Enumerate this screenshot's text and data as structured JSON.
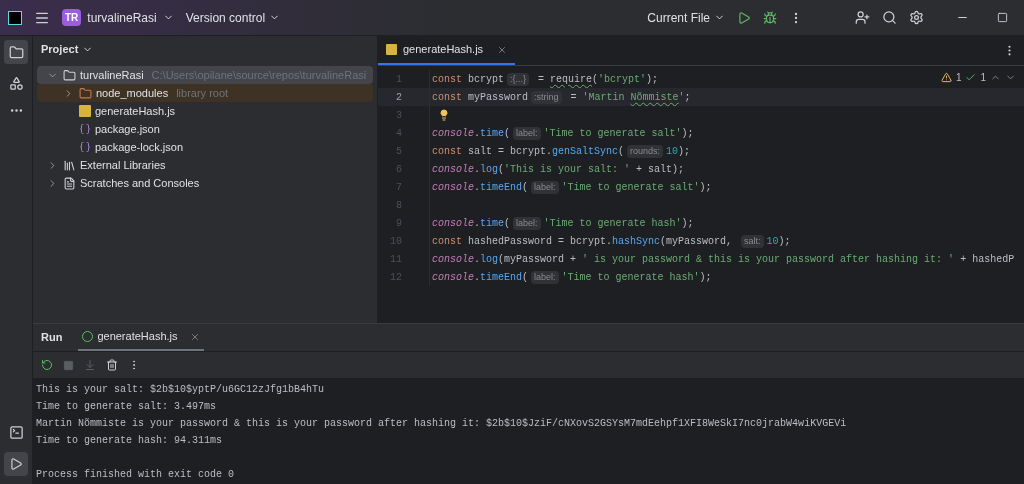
{
  "titlebar": {
    "app_initials": "TR",
    "project": "turvalineRasi",
    "vcs": "Version control",
    "run_config": "Current File"
  },
  "project_panel": {
    "title": "Project",
    "tree": [
      {
        "label": "turvalineRasi",
        "hint": "C:\\Users\\opilane\\source\\repos\\turvalineRasi",
        "kind": "folder",
        "expanded": true,
        "selected": true,
        "children": [
          {
            "label": "node_modules",
            "hint": "library root",
            "kind": "library-folder",
            "expanded": false,
            "selected": false
          },
          {
            "label": "generateHash.js",
            "kind": "js",
            "selected": false
          },
          {
            "label": "package.json",
            "kind": "json",
            "selected": false
          },
          {
            "label": "package-lock.json",
            "kind": "json",
            "selected": false
          }
        ]
      },
      {
        "label": "External Libraries",
        "kind": "library",
        "expanded": false,
        "selected": false
      },
      {
        "label": "Scratches and Consoles",
        "kind": "scratches",
        "expanded": false,
        "selected": false
      }
    ]
  },
  "editor": {
    "tabs": [
      {
        "label": "generateHash.js",
        "selected": true
      }
    ],
    "warnings": "1",
    "checks": "1",
    "lines": [
      {
        "number": "1",
        "current": false,
        "tokens": [
          {
            "kind": "kw",
            "text": "const "
          },
          {
            "kind": "plain",
            "text": "bcrypt"
          },
          {
            "kind": "hint",
            "text": ":{...}"
          },
          {
            "kind": "plain",
            "text": " = "
          },
          {
            "kind": "plain",
            "text": "require",
            "underline": true
          },
          {
            "kind": "plain",
            "text": "("
          },
          {
            "kind": "str",
            "text": "'bcrypt'"
          },
          {
            "kind": "plain",
            "text": ");"
          }
        ]
      },
      {
        "number": "2",
        "current": true,
        "tokens": [
          {
            "kind": "kw",
            "text": "const "
          },
          {
            "kind": "plain",
            "text": "myPassword"
          },
          {
            "kind": "hint",
            "text": ":string"
          },
          {
            "kind": "plain",
            "text": " = "
          },
          {
            "kind": "str",
            "text": "'Martin "
          },
          {
            "kind": "str",
            "text": "Nõmmiste",
            "underline": true
          },
          {
            "kind": "str",
            "text": "'"
          },
          {
            "kind": "plain",
            "text": ";"
          }
        ]
      },
      {
        "number": "3",
        "current": false,
        "tokens": [
          {
            "kind": "bulb"
          }
        ]
      },
      {
        "number": "4",
        "current": false,
        "tokens": [
          {
            "kind": "obj",
            "text": "console"
          },
          {
            "kind": "plain",
            "text": "."
          },
          {
            "kind": "fn",
            "text": "time"
          },
          {
            "kind": "plain",
            "text": "("
          },
          {
            "kind": "hint",
            "text": "label:"
          },
          {
            "kind": "str",
            "text": "'Time to generate salt'"
          },
          {
            "kind": "plain",
            "text": ");"
          }
        ]
      },
      {
        "number": "5",
        "current": false,
        "tokens": [
          {
            "kind": "kw",
            "text": "const "
          },
          {
            "kind": "plain",
            "text": "salt = bcrypt."
          },
          {
            "kind": "fn",
            "text": "genSaltSync"
          },
          {
            "kind": "plain",
            "text": "("
          },
          {
            "kind": "hint",
            "text": "rounds:"
          },
          {
            "kind": "num",
            "text": "10"
          },
          {
            "kind": "plain",
            "text": ");"
          }
        ]
      },
      {
        "number": "6",
        "current": false,
        "tokens": [
          {
            "kind": "obj",
            "text": "console"
          },
          {
            "kind": "plain",
            "text": "."
          },
          {
            "kind": "fn",
            "text": "log"
          },
          {
            "kind": "plain",
            "text": "("
          },
          {
            "kind": "str",
            "text": "'This is your salt: '"
          },
          {
            "kind": "plain",
            "text": " + salt);"
          }
        ]
      },
      {
        "number": "7",
        "current": false,
        "tokens": [
          {
            "kind": "obj",
            "text": "console"
          },
          {
            "kind": "plain",
            "text": "."
          },
          {
            "kind": "fn",
            "text": "timeEnd"
          },
          {
            "kind": "plain",
            "text": "("
          },
          {
            "kind": "hint",
            "text": "label:"
          },
          {
            "kind": "str",
            "text": "'Time to generate salt'"
          },
          {
            "kind": "plain",
            "text": ");"
          }
        ]
      },
      {
        "number": "8",
        "current": false
      },
      {
        "number": "9",
        "current": false,
        "tokens": [
          {
            "kind": "obj",
            "text": "console"
          },
          {
            "kind": "plain",
            "text": "."
          },
          {
            "kind": "fn",
            "text": "time"
          },
          {
            "kind": "plain",
            "text": "("
          },
          {
            "kind": "hint",
            "text": "label:"
          },
          {
            "kind": "str",
            "text": "'Time to generate hash'"
          },
          {
            "kind": "plain",
            "text": ");"
          }
        ]
      },
      {
        "number": "10",
        "current": false,
        "tokens": [
          {
            "kind": "kw",
            "text": "const "
          },
          {
            "kind": "plain",
            "text": "hashedPassword = bcrypt."
          },
          {
            "kind": "fn",
            "text": "hashSync"
          },
          {
            "kind": "plain",
            "text": "(myPassword, "
          },
          {
            "kind": "hint",
            "text": "salt:"
          },
          {
            "kind": "num",
            "text": "10"
          },
          {
            "kind": "plain",
            "text": ");"
          }
        ]
      },
      {
        "number": "11",
        "current": false,
        "tokens": [
          {
            "kind": "obj",
            "text": "console"
          },
          {
            "kind": "plain",
            "text": "."
          },
          {
            "kind": "fn",
            "text": "log"
          },
          {
            "kind": "plain",
            "text": "(myPassword + "
          },
          {
            "kind": "str",
            "text": "' is your password & this is your password after hashing it: '"
          },
          {
            "kind": "plain",
            "text": " + hashedP"
          }
        ]
      },
      {
        "number": "12",
        "current": false,
        "tokens": [
          {
            "kind": "obj",
            "text": "console"
          },
          {
            "kind": "plain",
            "text": "."
          },
          {
            "kind": "fn",
            "text": "timeEnd"
          },
          {
            "kind": "plain",
            "text": "("
          },
          {
            "kind": "hint",
            "text": "label:"
          },
          {
            "kind": "str",
            "text": "'Time to generate hash'"
          },
          {
            "kind": "plain",
            "text": ");"
          }
        ]
      }
    ]
  },
  "run_panel": {
    "title": "Run",
    "tabs": [
      {
        "label": "generateHash.js",
        "selected": true
      }
    ],
    "output": [
      "This is your salt: $2b$10$yptP/u6GC12zJfg1bB4hTu",
      "Time to generate salt: 3.497ms",
      "Martin Nõmmiste is your password & this is your password after hashing it: $2b$10$JziF/cNXovS2GSYsM7mdEehpf1XFI8WeSkI7nc0jrabW4wiKVGEVi",
      "Time to generate hash: 94.311ms"
    ],
    "exit_message": "Process finished with exit code 0"
  }
}
